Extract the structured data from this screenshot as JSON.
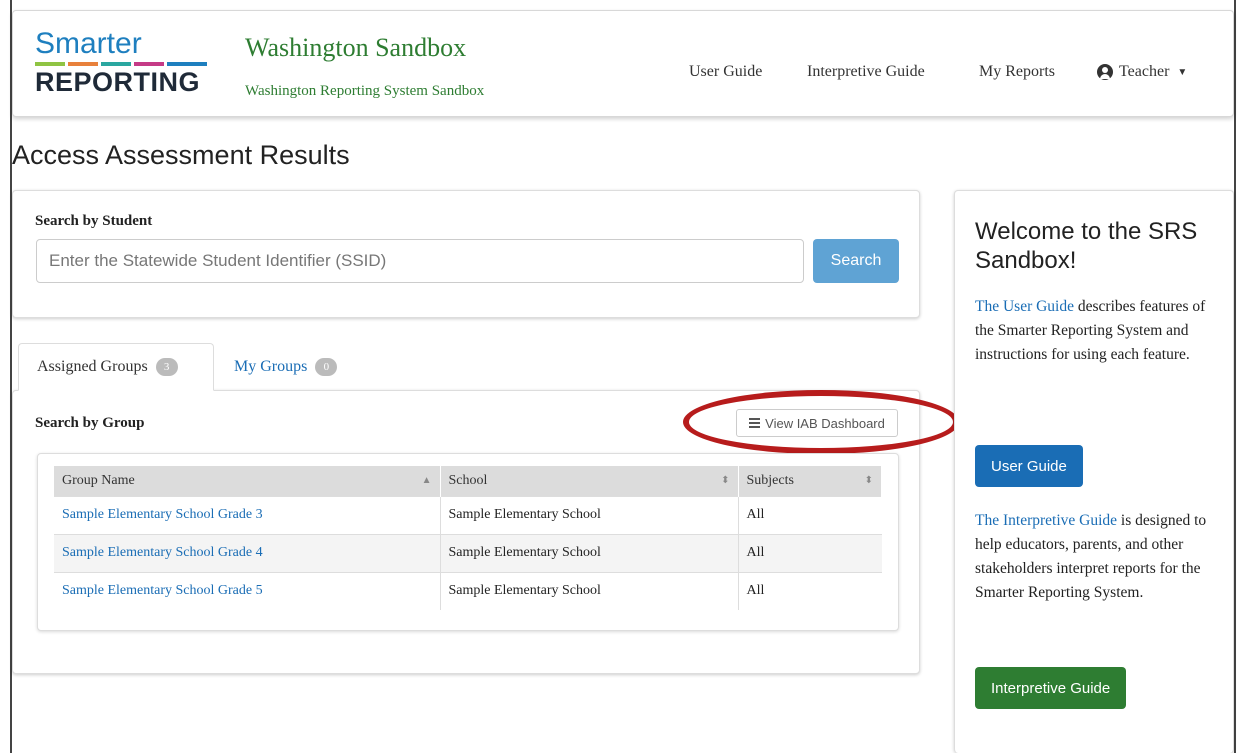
{
  "header": {
    "logo_top": "Smarter",
    "logo_bottom": "REPORTING",
    "title": "Washington Sandbox",
    "subtitle": "Washington Reporting System Sandbox",
    "nav": [
      "User Guide",
      "Interpretive Guide",
      "My Reports"
    ],
    "user_label": "Teacher",
    "logo_bar_colors": [
      "#8fc443",
      "#e8813b",
      "#2aa7a0",
      "#c53a86",
      "#1e7fbf"
    ]
  },
  "page_title": "Access Assessment Results",
  "search": {
    "label": "Search by Student",
    "placeholder": "Enter the Statewide Student Identifier (SSID)",
    "button": "Search"
  },
  "tabs": [
    {
      "label": "Assigned Groups",
      "count": "3"
    },
    {
      "label": "My Groups",
      "count": "0"
    }
  ],
  "groups": {
    "label": "Search by Group",
    "iab_button": "View IAB Dashboard",
    "columns": [
      "Group Name",
      "School",
      "Subjects"
    ],
    "rows": [
      {
        "name": "Sample Elementary School Grade 3",
        "school": "Sample Elementary School",
        "subjects": "All"
      },
      {
        "name": "Sample Elementary School Grade 4",
        "school": "Sample Elementary School",
        "subjects": "All"
      },
      {
        "name": "Sample Elementary School Grade 5",
        "school": "Sample Elementary School",
        "subjects": "All"
      }
    ]
  },
  "sidebar": {
    "title": "Welcome to the SRS Sandbox!",
    "user_guide_link": "The User Guide",
    "user_guide_text": " describes features of the Smarter Reporting System and instructions for using each feature.",
    "user_guide_button": "User Guide",
    "interp_link": "The Interpretive Guide",
    "interp_text": " is designed to help educators, parents, and other stakeholders interpret reports for the Smarter Reporting System.",
    "interp_button": "Interpretive Guide"
  },
  "colors": {
    "accent_blue": "#1a6db5",
    "accent_green": "#2e7d32",
    "highlight_red": "#b71c1c"
  }
}
